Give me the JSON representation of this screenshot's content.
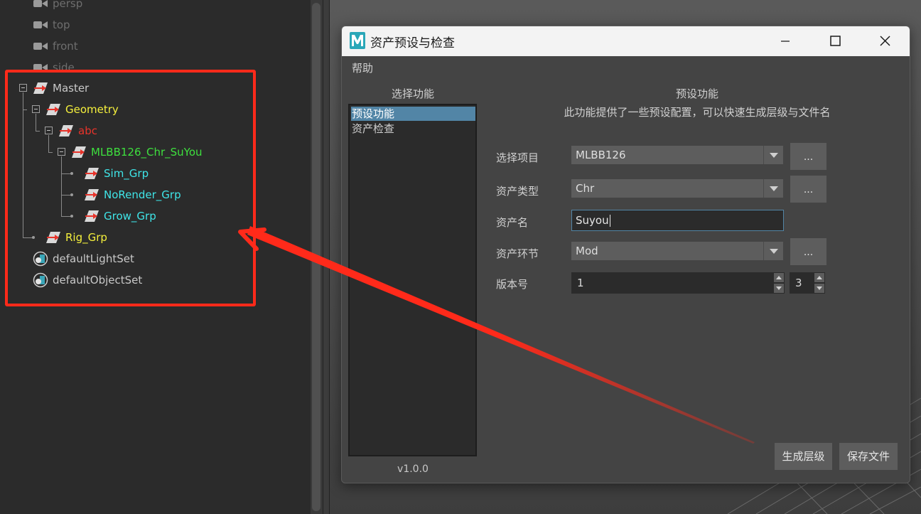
{
  "outliner": {
    "cameras": [
      {
        "label": "persp",
        "icon": "camera-icon"
      },
      {
        "label": "top",
        "icon": "camera-icon"
      },
      {
        "label": "front",
        "icon": "camera-icon"
      },
      {
        "label": "side",
        "icon": "camera-icon"
      }
    ],
    "tree": [
      {
        "label": "Master",
        "color": "#c8c8c8",
        "icon": "transform-group-icon"
      },
      {
        "label": "Geometry",
        "color": "#f5f03c",
        "icon": "transform-group-icon"
      },
      {
        "label": "abc",
        "color": "#e8332a",
        "icon": "transform-group-icon"
      },
      {
        "label": "MLBB126_Chr_SuYou",
        "color": "#3ee03e",
        "icon": "transform-group-icon"
      },
      {
        "label": "Sim_Grp",
        "color": "#3fe5e8",
        "icon": "transform-group-icon"
      },
      {
        "label": "NoRender_Grp",
        "color": "#3fe5e8",
        "icon": "transform-group-icon"
      },
      {
        "label": "Grow_Grp",
        "color": "#3fe5e8",
        "icon": "transform-group-icon"
      },
      {
        "label": "Rig_Grp",
        "color": "#f5f03c",
        "icon": "transform-group-icon"
      }
    ],
    "sets": [
      {
        "label": "defaultLightSet",
        "icon": "object-set-icon"
      },
      {
        "label": "defaultObjectSet",
        "icon": "object-set-icon"
      }
    ],
    "annotation_color": "#ff2a1a"
  },
  "dialog": {
    "title": "资产预设与检查",
    "app_icon": "maya-logo-icon",
    "menu": {
      "help": "帮助"
    },
    "left_panel": {
      "title": "选择功能",
      "items": [
        "预设功能",
        "资产检查"
      ],
      "selected": "预设功能",
      "version": "v1.0.0"
    },
    "right_panel": {
      "title": "预设功能",
      "description": "此功能提供了一些预设配置，可以快速生成层级与文件名",
      "fields": {
        "project": {
          "label": "选择项目",
          "value": "MLBB126",
          "button": "..."
        },
        "asset_type": {
          "label": "资产类型",
          "value": "Chr",
          "button": "..."
        },
        "asset_name": {
          "label": "资产名",
          "value": "Suyou"
        },
        "asset_stage": {
          "label": "资产环节",
          "value": "Mod",
          "button": "..."
        },
        "version": {
          "label": "版本号",
          "major": "1",
          "minor": "3"
        }
      },
      "buttons": {
        "generate_hierarchy": "生成层级",
        "save_file": "保存文件"
      }
    },
    "accent_color": "#5285a6"
  }
}
